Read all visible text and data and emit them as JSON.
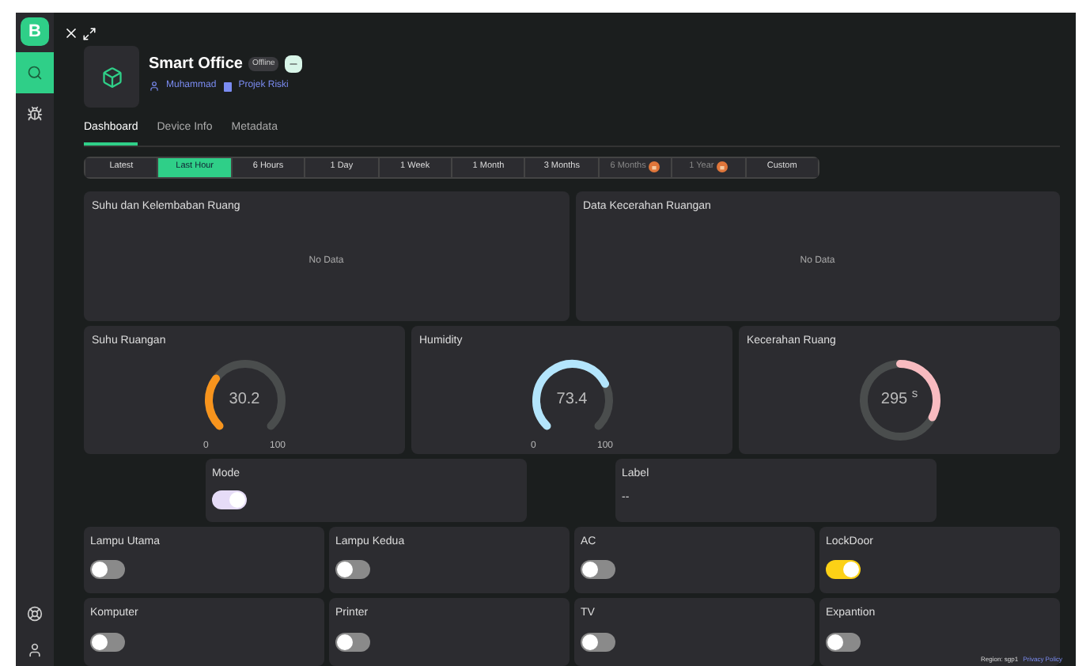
{
  "app": {
    "logo": "B"
  },
  "sidebar": {
    "items": [
      {
        "selected": true
      },
      {
        "selected": false
      }
    ]
  },
  "device": {
    "name": "Smart Office",
    "status": "Offline",
    "owner": "Muhammad",
    "project": "Projek Riski"
  },
  "tabs": [
    {
      "label": "Dashboard",
      "selected": true
    },
    {
      "label": "Device Info",
      "selected": false
    },
    {
      "label": "Metadata",
      "selected": false
    }
  ],
  "ranges": [
    {
      "label": "Latest",
      "selected": false,
      "locked": false
    },
    {
      "label": "Last Hour",
      "selected": true,
      "locked": false
    },
    {
      "label": "6 Hours",
      "selected": false,
      "locked": false
    },
    {
      "label": "1 Day",
      "selected": false,
      "locked": false
    },
    {
      "label": "1 Week",
      "selected": false,
      "locked": false
    },
    {
      "label": "1 Month",
      "selected": false,
      "locked": false
    },
    {
      "label": "3 Months",
      "selected": false,
      "locked": false
    },
    {
      "label": "6 Months",
      "selected": false,
      "locked": true
    },
    {
      "label": "1 Year",
      "selected": false,
      "locked": true
    },
    {
      "label": "Custom",
      "selected": false,
      "locked": false
    }
  ],
  "charts": [
    {
      "title": "Suhu dan Kelembaban Ruang",
      "empty": "No Data"
    },
    {
      "title": "Data Kecerahan Ruangan",
      "empty": "No Data"
    }
  ],
  "gauges": [
    {
      "kind": "arc",
      "title": "Suhu Ruangan",
      "value": "30.2",
      "min": "0",
      "max": "100",
      "color": "#f7941d"
    },
    {
      "kind": "arc",
      "title": "Humidity",
      "value": "73.4",
      "min": "0",
      "max": "100",
      "color": "#b3e5fc"
    },
    {
      "kind": "ring",
      "title": "Kecerahan Ruang",
      "value": "295 $^{s}$",
      "color": "#f8bbc0"
    }
  ],
  "mode": {
    "title": "Mode",
    "on": true,
    "color": "#e6dcf7"
  },
  "label": {
    "title": "Label",
    "value": "--"
  },
  "switches": [
    {
      "title": "Lampu Utama",
      "on": false
    },
    {
      "title": "Lampu Kedua",
      "on": false
    },
    {
      "title": "AC",
      "on": false
    },
    {
      "title": "LockDoor",
      "on": true,
      "color": "#fcd116"
    },
    {
      "title": "Komputer",
      "on": false
    },
    {
      "title": "Printer",
      "on": false
    },
    {
      "title": "TV",
      "on": false
    },
    {
      "title": "Expantion",
      "on": false
    }
  ],
  "footer": {
    "region": "Region: sgp1",
    "link": "Privacy Policy"
  }
}
